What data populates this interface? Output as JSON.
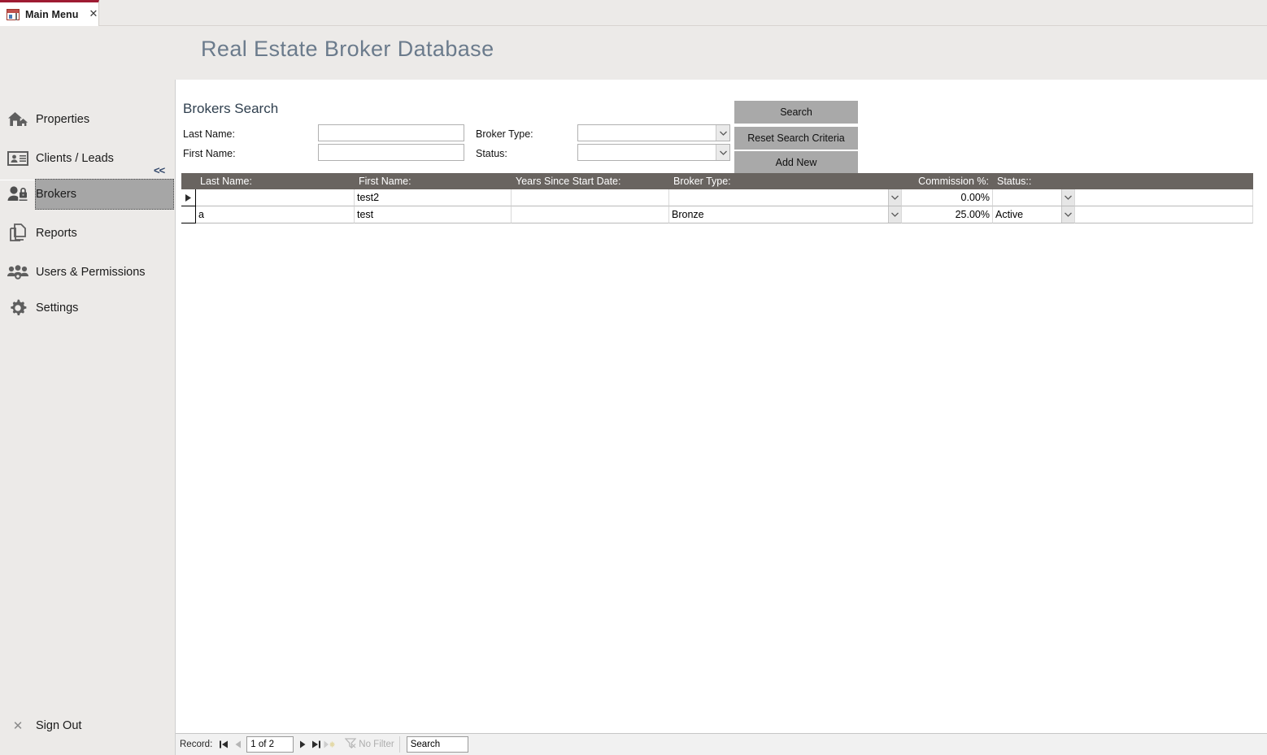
{
  "tab": {
    "label": "Main Menu",
    "close_label": "✕",
    "icon": "form-icon"
  },
  "header": {
    "title": "Real Estate Broker Database",
    "title_color": "#6b7b8c"
  },
  "navpane": {
    "collapse_label": "<<",
    "items": [
      {
        "label": "Properties",
        "icon": "house-icon",
        "selected": false
      },
      {
        "label": "Clients / Leads",
        "icon": "id-card-icon",
        "selected": false
      },
      {
        "label": "Brokers",
        "icon": "broker-icon",
        "selected": true
      },
      {
        "label": "Reports",
        "icon": "documents-icon",
        "selected": false
      },
      {
        "label": "Users & Permissions",
        "icon": "users-icon",
        "selected": false
      },
      {
        "label": "Settings",
        "icon": "gear-icon",
        "selected": false
      }
    ],
    "signout": {
      "label": "Sign Out",
      "icon": "close-x-icon"
    }
  },
  "search_panel": {
    "title": "Brokers Search",
    "fields": {
      "last_name_label": "Last Name:",
      "last_name_value": "",
      "first_name_label": "First Name:",
      "first_name_value": "",
      "broker_type_label": "Broker Type:",
      "broker_type_value": "",
      "status_label": "Status:",
      "status_value": ""
    },
    "buttons": {
      "search": "Search",
      "reset": "Reset Search Criteria",
      "add_new": "Add New"
    }
  },
  "datasheet": {
    "columns": [
      "Last Name:",
      "First Name:",
      "Years Since Start Date:",
      "Broker Type:",
      "Commission %:",
      "Status::"
    ],
    "rows": [
      {
        "current": true,
        "last_name": "",
        "first_name": "test2",
        "years_since_start": "",
        "broker_type": "",
        "commission": "0.00%",
        "status": ""
      },
      {
        "current": false,
        "last_name": "a",
        "first_name": "test",
        "years_since_start": "",
        "broker_type": "Bronze",
        "commission": "25.00%",
        "status": "Active"
      }
    ]
  },
  "record_nav": {
    "label": "Record:",
    "first_icon": "▌◀",
    "prev_icon": "◀",
    "position": "1 of 2",
    "next_icon": "▶",
    "last_icon": "▶▌",
    "new_icon": "▶✳",
    "filter_text": "No Filter",
    "filter_icon": "funnel-icon",
    "search_placeholder": "Search",
    "search_value": "Search"
  }
}
